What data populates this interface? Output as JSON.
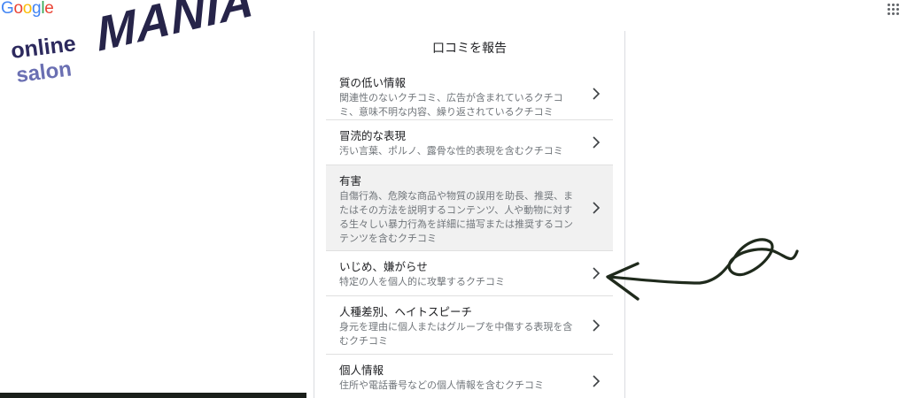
{
  "google_logo": {
    "letters": [
      {
        "char": "G",
        "color": "#4285f4"
      },
      {
        "char": "o",
        "color": "#ea4335"
      },
      {
        "char": "o",
        "color": "#fbbc05"
      },
      {
        "char": "g",
        "color": "#4285f4"
      },
      {
        "char": "l",
        "color": "#34a853"
      },
      {
        "char": "e",
        "color": "#ea4335"
      }
    ]
  },
  "apps_icon": "grid-dots-icon",
  "brand": {
    "line1": "online",
    "line2": "salon",
    "wordmark": "MANIA",
    "colors": {
      "online": "#2d2a5e",
      "salon": "#6a6fb2",
      "mania": "#262449"
    }
  },
  "report": {
    "title": "口コミを報告",
    "options": [
      {
        "title": "質の低い情報",
        "description": "関連性のないクチコミ、広告が含まれているクチコミ、意味不明な内容、繰り返されているクチコミ",
        "highlighted": false
      },
      {
        "title": "冒涜的な表現",
        "description": "汚い言葉、ポルノ、露骨な性的表現を含むクチコミ",
        "highlighted": false
      },
      {
        "title": "有害",
        "description": "自傷行為、危険な商品や物質の誤用を助長、推奨、またはその方法を説明するコンテンツ、人や動物に対する生々しい暴力行為を詳細に描写または推奨するコンテンツを含むクチコミ",
        "highlighted": true
      },
      {
        "title": "いじめ、嫌がらせ",
        "description": "特定の人を個人的に攻撃するクチコミ",
        "highlighted": false
      },
      {
        "title": "人種差別、ヘイトスピーチ",
        "description": "身元を理由に個人またはグループを中傷する表現を含むクチコミ",
        "highlighted": false
      },
      {
        "title": "個人情報",
        "description": "住所や電話番号などの個人情報を含むクチコミ",
        "highlighted": false
      }
    ],
    "chevron_icon": "chevron-right-icon"
  },
  "annotation": {
    "icon": "hand-drawn-arrow-icon",
    "color": "#1f2a1c"
  }
}
